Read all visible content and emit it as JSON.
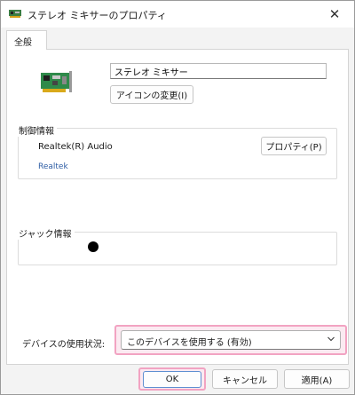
{
  "window": {
    "title": "ステレオ ミキサーのプロパティ",
    "close_glyph": "✕"
  },
  "tabs": [
    {
      "label": "全般",
      "selected": true
    }
  ],
  "device": {
    "name_value": "ステレオ ミキサー",
    "change_icon_label": "アイコンの変更(I)"
  },
  "controller": {
    "group_label": "制御情報",
    "name": "Realtek(R) Audio",
    "vendor": "Realtek",
    "properties_label": "プロパティ(P)"
  },
  "jack": {
    "group_label": "ジャック情報"
  },
  "usage": {
    "label": "デバイスの使用状況:",
    "selected": "このデバイスを使用する (有効)"
  },
  "footer": {
    "ok_label": "OK",
    "cancel_label": "キャンセル",
    "apply_label": "適用(A)"
  },
  "colors": {
    "highlight_border": "#f2a3c2",
    "link_blue": "#2f5ea5",
    "ok_border": "#5e8fd1"
  }
}
